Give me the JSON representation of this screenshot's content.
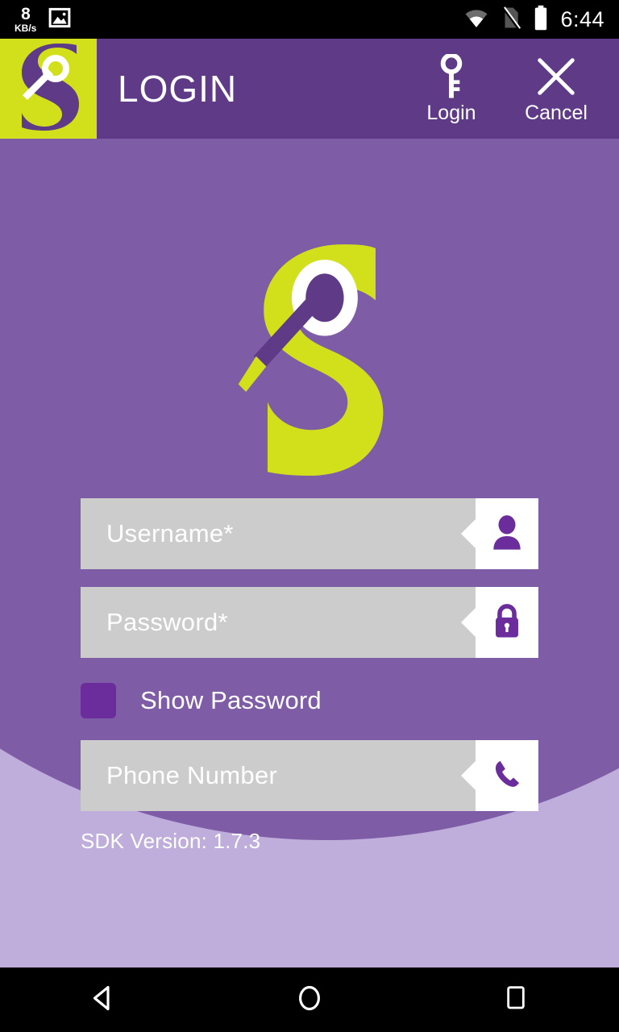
{
  "status_bar": {
    "network_speed_value": "8",
    "network_speed_unit": "KB/s",
    "screenshot_icon": "image-icon",
    "wifi_icon": "wifi-icon",
    "sim_icon": "no-sim-icon",
    "battery_icon": "battery-full-icon",
    "time": "6:44"
  },
  "app_bar": {
    "logo_icon": "app-logo-icon",
    "title": "LOGIN",
    "actions": [
      {
        "label": "Login",
        "icon": "key-icon"
      },
      {
        "label": "Cancel",
        "icon": "close-icon"
      }
    ]
  },
  "hero": {
    "logo_icon": "brand-logo-icon"
  },
  "form": {
    "fields": [
      {
        "name": "username",
        "placeholder": "Username*",
        "value": "",
        "icon": "person-icon"
      },
      {
        "name": "password",
        "placeholder": "Password*",
        "value": "",
        "icon": "lock-icon"
      },
      {
        "name": "phone",
        "placeholder": "Phone Number",
        "value": "",
        "icon": "phone-icon"
      }
    ],
    "show_password_label": "Show Password",
    "show_password_checked": false,
    "sdk_version": "SDK Version: 1.7.3"
  },
  "nav_bar": {
    "back": "back-triangle-icon",
    "home": "home-circle-icon",
    "recents": "recents-square-icon"
  },
  "colors": {
    "brand_purple": "#5E3A87",
    "body_purple": "#7E5CA6",
    "light_purple": "#BFAEDB",
    "lime": "#D2E01C",
    "field_gray": "#CCCCCC",
    "checkbox_purple": "#6B2D9B",
    "icon_purple": "#6B2D9B",
    "white": "#FFFFFF",
    "black": "#000000"
  }
}
